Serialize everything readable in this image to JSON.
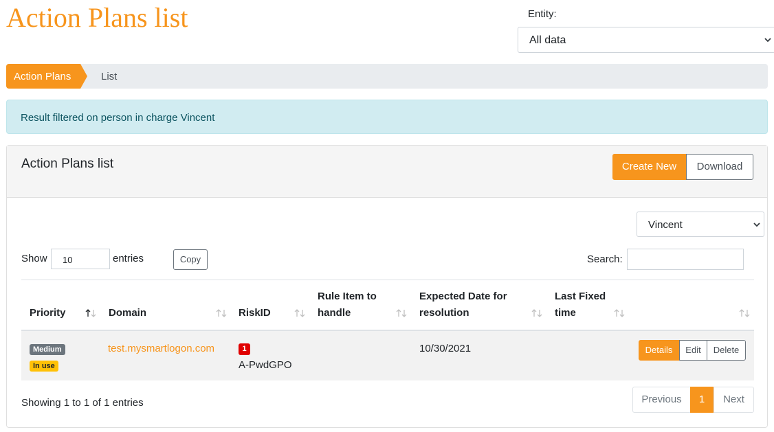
{
  "page": {
    "title": "Action Plans list"
  },
  "entity": {
    "label": "Entity:",
    "selected": "All data"
  },
  "breadcrumb": {
    "active": "Action Plans",
    "current": "List"
  },
  "alert": {
    "text": "Result filtered on person in charge Vincent"
  },
  "card": {
    "title": "Action Plans list",
    "create_label": "Create New",
    "download_label": "Download",
    "person_filter": "Vincent"
  },
  "controls": {
    "show_label": "Show",
    "show_value": "10",
    "entries_label": "entries",
    "copy_label": "Copy",
    "search_label": "Search:",
    "search_value": ""
  },
  "table": {
    "headers": [
      "Priority",
      "Domain",
      "RiskID",
      "Rule Item to handle",
      "Expected Date for resolution",
      "Last Fixed time",
      ""
    ],
    "rows": [
      {
        "priority": "Medium",
        "status": "In use",
        "domain": "test.mysmartlogon.com",
        "risk_count": "1",
        "risk_id": "A-PwdGPO",
        "rule_item": "",
        "expected_date": "10/30/2021",
        "last_fixed": "",
        "actions": {
          "details": "Details",
          "edit": "Edit",
          "delete": "Delete"
        }
      }
    ]
  },
  "footer": {
    "info": "Showing 1 to 1 of 1 entries",
    "prev": "Previous",
    "page": "1",
    "next": "Next"
  },
  "colors": {
    "accent": "#f7951d",
    "alert_bg": "#d1ecf1",
    "risk_badge": "#e00000",
    "inuse_badge": "#ffc107",
    "medium_badge": "#6c757d"
  },
  "icons": {
    "select_chevron": "chevron-down-icon",
    "sort_active": "sort-asc-icon",
    "sort": "sort-icon"
  }
}
